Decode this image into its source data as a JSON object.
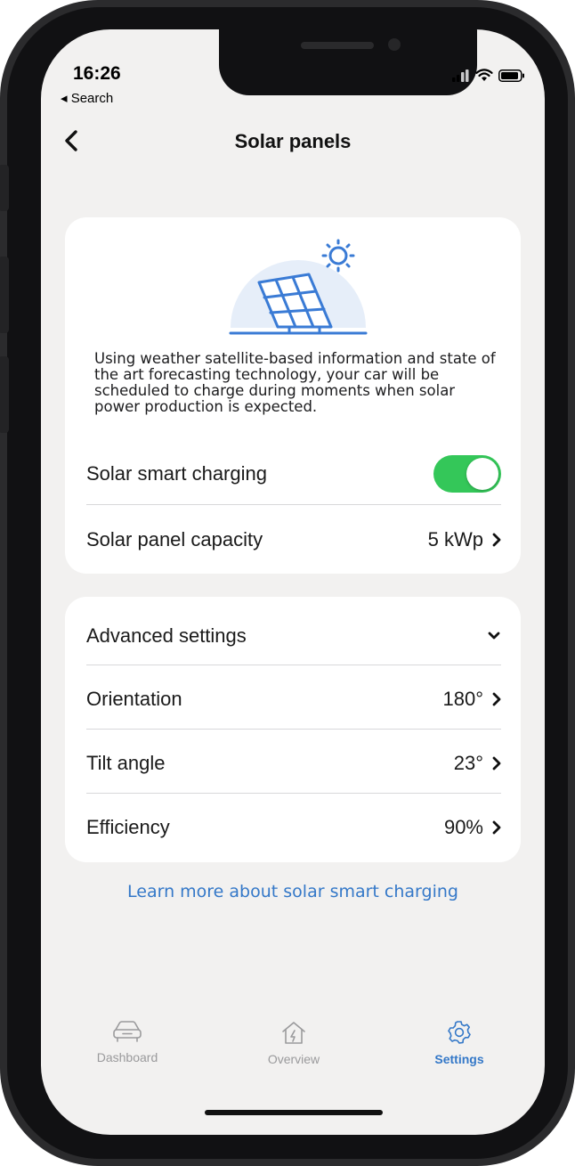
{
  "status_bar": {
    "time": "16:26",
    "back_app": "◂ Search"
  },
  "header": {
    "title": "Solar panels"
  },
  "info_card": {
    "description": "Using weather satellite-based information and state of the art forecasting technology, your car will be scheduled to charge during moments when solar power production is expected.",
    "smart_charging": {
      "label": "Solar smart charging",
      "enabled": true
    },
    "capacity": {
      "label": "Solar panel capacity",
      "value": "5 kWp"
    }
  },
  "advanced_card": {
    "title": "Advanced settings",
    "rows": [
      {
        "label": "Orientation",
        "value": "180°"
      },
      {
        "label": "Tilt angle",
        "value": "23°"
      },
      {
        "label": "Efficiency",
        "value": "90%"
      }
    ]
  },
  "learn_more_link": "Learn more about solar smart charging",
  "tabbar": {
    "tabs": [
      {
        "label": "Dashboard",
        "icon": "car-icon",
        "active": false
      },
      {
        "label": "Overview",
        "icon": "home-energy-icon",
        "active": false
      },
      {
        "label": "Settings",
        "icon": "gear-icon",
        "active": true
      }
    ]
  },
  "colors": {
    "accent": "#3478c8",
    "toggle_on": "#34c759",
    "background": "#f2f1f0",
    "solar_blue": "#3a7bd5"
  }
}
